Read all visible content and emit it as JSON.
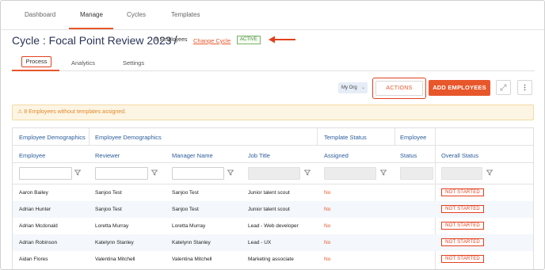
{
  "nav": {
    "tabs": [
      {
        "label": "Dashboard"
      },
      {
        "label": "Manage"
      },
      {
        "label": "Cycles"
      },
      {
        "label": "Templates"
      }
    ],
    "active": "Manage"
  },
  "header": {
    "title": "Cycle : Focal Point Review 2023",
    "separator": "/",
    "employee_count": "8 Employees",
    "change_cycle": "Change Cycle",
    "status": "ACTIVE"
  },
  "subtabs": {
    "items": [
      {
        "label": "Process"
      },
      {
        "label": "Analytics"
      },
      {
        "label": "Settings"
      }
    ],
    "active": "Process"
  },
  "toolbar": {
    "org_select": "My Org",
    "actions_label": "ACTIONS",
    "add_label": "ADD EMPLOYEES"
  },
  "warning": {
    "text": "8 Employees without templates assigned."
  },
  "table": {
    "group_headers": [
      "Employee Demographics",
      "Employee Demographics",
      "Template Status",
      "Employee"
    ],
    "columns": [
      "Employee",
      "Reviewer",
      "Manager Name",
      "Job Title",
      "Assigned",
      "Status",
      "Overall Status"
    ],
    "rows": [
      {
        "employee": "Aaron Bailey",
        "reviewer": "Sanjoo Test",
        "manager": "Sanjoo Test",
        "job": "Junior talent scout",
        "assigned": "No",
        "status": "",
        "overall": "NOT STARTED"
      },
      {
        "employee": "Adrian Hunter",
        "reviewer": "Sanjoo Test",
        "manager": "Sanjoo Test",
        "job": "Junior talent scout",
        "assigned": "No",
        "status": "",
        "overall": "NOT STARTED"
      },
      {
        "employee": "Adrian Mcdonald",
        "reviewer": "Loretta Murray",
        "manager": "Loretta Murray",
        "job": "Lead - Web developer",
        "assigned": "No",
        "status": "",
        "overall": "NOT STARTED"
      },
      {
        "employee": "Adrian Robinson",
        "reviewer": "Katelynn Stanley",
        "manager": "Katelynn Stanley",
        "job": "Lead - UX",
        "assigned": "No",
        "status": "",
        "overall": "NOT STARTED"
      },
      {
        "employee": "Aidan Flores",
        "reviewer": "Valentina Mitchell",
        "manager": "Valentina Mitchell",
        "job": "Marketing associate",
        "assigned": "No",
        "status": "",
        "overall": "NOT STARTED"
      }
    ]
  },
  "colors": {
    "accent": "#e8572b",
    "highlight": "#e3401f",
    "header_text": "#2b5d9a",
    "title_text": "#2a3558",
    "active_badge": "#4d8a3e",
    "warning_text": "#e0892e"
  },
  "icons": [
    "warning-icon",
    "chevron-down-icon",
    "expand-icon",
    "more-vertical-icon",
    "filter-icon",
    "arrow-left-icon"
  ]
}
